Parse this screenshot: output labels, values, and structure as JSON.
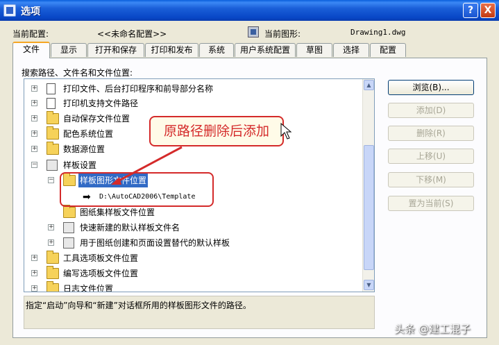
{
  "window": {
    "title": "选项",
    "help_btn": "?",
    "close_btn": "X"
  },
  "config": {
    "current_profile_label": "当前配置:",
    "current_profile_value": "<<未命名配置>>",
    "current_drawing_label": "当前图形:",
    "current_drawing_value": "Drawing1.dwg"
  },
  "tabs": [
    "文件",
    "显示",
    "打开和保存",
    "打印和发布",
    "系统",
    "用户系统配置",
    "草图",
    "选择",
    "配置"
  ],
  "section_label": "搜索路径、文件名和文件位置:",
  "tree": {
    "items": [
      {
        "label": "打印文件、后台打印程序和前导部分名称"
      },
      {
        "label": "打印机支持文件路径"
      },
      {
        "label": "自动保存文件位置"
      },
      {
        "label": "配色系统位置"
      },
      {
        "label": "数据源位置"
      },
      {
        "label": "样板设置"
      },
      {
        "label": "样板图形文件位置"
      },
      {
        "label": "D:\\AutoCAD2006\\Template"
      },
      {
        "label": "图纸集样板文件位置"
      },
      {
        "label": "快速新建的默认样板文件名"
      },
      {
        "label": "用于图纸创建和页面设置替代的默认样板"
      },
      {
        "label": "工具选项板文件位置"
      },
      {
        "label": "编写选项板文件位置"
      },
      {
        "label": "日志文件位置"
      }
    ]
  },
  "buttons": {
    "browse": "浏览(B)...",
    "add": "添加(D)",
    "remove": "删除(R)",
    "move_up": "上移(U)",
    "move_down": "下移(M)",
    "set_current": "置为当前(S)"
  },
  "description": "指定“启动”向导和“新建”对话框所用的样板图形文件的路径。",
  "annotation": "原路径删除后添加",
  "watermark": "头条 @建工混子",
  "colors": {
    "titlebar": "#0a46c8",
    "selection": "#316ac5",
    "annotation": "#d42a2a"
  }
}
